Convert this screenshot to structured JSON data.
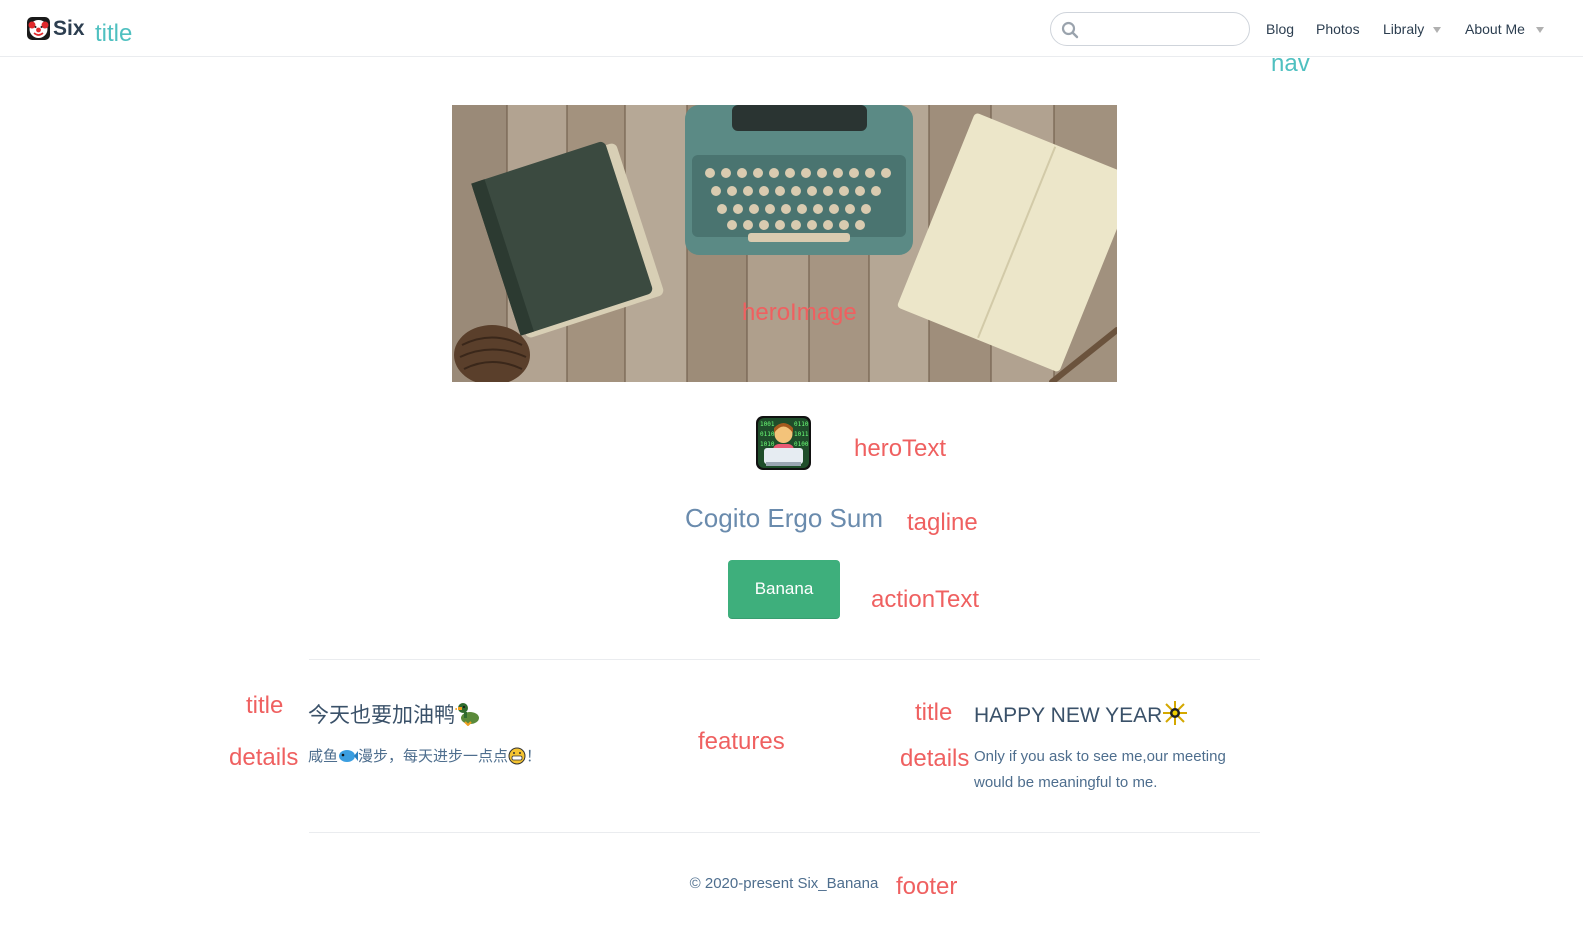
{
  "navbar": {
    "site_name": "Six",
    "search": {
      "placeholder": "",
      "value": ""
    },
    "links": [
      {
        "label": "Blog"
      },
      {
        "label": "Photos"
      },
      {
        "label": "Libraly",
        "dropdown": true
      },
      {
        "label": "About Me",
        "dropdown": true
      }
    ]
  },
  "hero": {
    "tagline": "Cogito Ergo Sum",
    "action_text": "Banana"
  },
  "features": [
    {
      "title": "今天也要加油鸭",
      "title_emoji": "duck-icon",
      "details_pre": "咸鱼",
      "details_emoji_1": "fish-icon",
      "details_mid": "漫步，每天进步一点点",
      "details_emoji_2": "grin-icon",
      "details_post": "！"
    },
    {
      "title": "HAPPY NEW YEAR",
      "title_emoji": "firework-icon",
      "details": "Only if you ask to see me,our meeting would be meaningful to me."
    }
  ],
  "footer": {
    "text": "© 2020-present Six_Banana"
  },
  "annotations": {
    "title": "title",
    "nav": "nav",
    "hero_image": "heroImage",
    "hero_text": "heroText",
    "tagline": "tagline",
    "action_text": "actionText",
    "feature_title": "title",
    "feature_details": "details",
    "features": "features",
    "footer": "footer"
  },
  "colors": {
    "accent": "#3eaf7c",
    "text": "#2c3e50",
    "tagline": "#6a8bad",
    "annotation_red": "#ef6060",
    "annotation_teal": "#4fc0c0"
  }
}
